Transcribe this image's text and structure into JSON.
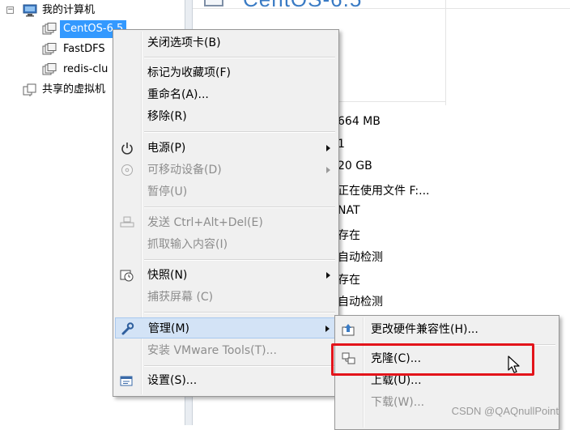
{
  "tree": {
    "root_label": "我的计算机",
    "root_expander": "−",
    "items": [
      {
        "label": "CentOS-6.5",
        "selected": true
      },
      {
        "label": "FastDFS"
      },
      {
        "label": "redis-clu"
      }
    ],
    "shared_label": "共享的虚拟机"
  },
  "right_panel": {
    "title": "CentOS-6.5",
    "specs": [
      "664 MB",
      "1",
      "20 GB",
      "正在使用文件 F:...",
      "NAT",
      "存在",
      "自动检测",
      "存在",
      "自动检测"
    ]
  },
  "context_menu": {
    "close_tab": "关闭选项卡(B)",
    "favorite": "标记为收藏项(F)",
    "rename": "重命名(A)...",
    "remove": "移除(R)",
    "power": "电源(P)",
    "removable": "可移动设备(D)",
    "pause": "暂停(U)",
    "send_cad": "发送 Ctrl+Alt+Del(E)",
    "grab_input": "抓取输入内容(I)",
    "snapshot": "快照(N)",
    "capture": "捕获屏幕 (C)",
    "manage": "管理(M)",
    "install_tools": "安装 VMware Tools(T)...",
    "settings": "设置(S)..."
  },
  "submenu": {
    "hw_compat": "更改硬件兼容性(H)...",
    "clone": "克隆(C)...",
    "upload": "上载(U)...",
    "download": "下载(W)..."
  },
  "watermark": "CSDN @QAQnullPoint",
  "colors": {
    "highlight_box": "#e3141b",
    "selection": "#3399ff",
    "menu_hover": "#d3e3f6"
  }
}
